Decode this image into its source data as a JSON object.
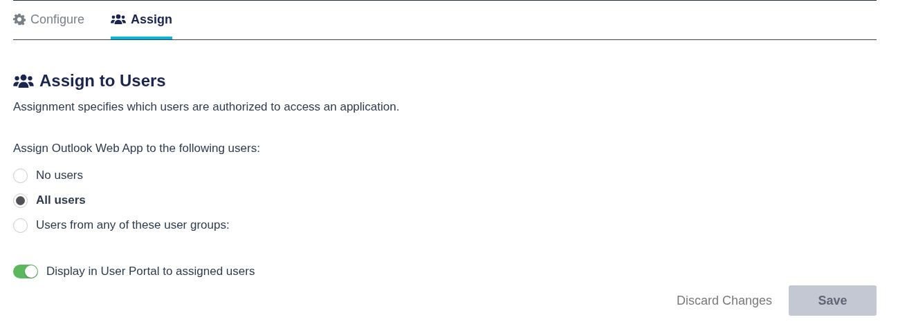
{
  "tabs": [
    {
      "kind": "gear",
      "label": "Configure",
      "selected": false
    },
    {
      "kind": "people",
      "label": "Assign",
      "selected": true
    }
  ],
  "section": {
    "title": "Assign to Users",
    "description": "Assignment specifies which users are authorized to access an application.",
    "prompt": "Assign Outlook Web App to the following users:"
  },
  "options": [
    {
      "label": "No users",
      "selected": false
    },
    {
      "label": "All users",
      "selected": true
    },
    {
      "label": "Users from any of these user groups:",
      "selected": false
    }
  ],
  "toggle": {
    "label": "Display in User Portal to assigned users",
    "on": true
  },
  "buttons": {
    "discard": "Discard Changes",
    "save": {
      "label": "Save",
      "disabled": true
    }
  }
}
